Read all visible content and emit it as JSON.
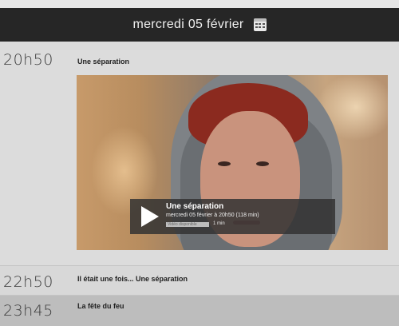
{
  "header": {
    "date": "mercredi 05 février",
    "calendar_icon": "calendar-icon"
  },
  "schedule": [
    {
      "time": "20h50",
      "title": "Une séparation"
    },
    {
      "time": "22h50",
      "title": "Il était une fois... Une séparation"
    },
    {
      "time": "23h45",
      "title": "La fête du feu"
    }
  ],
  "player": {
    "title": "Une séparation",
    "subtitle": "mercredi 05 février à 20h50 (118 min)",
    "bar_label": "Vidéo disponible",
    "duration": "1 min",
    "play_icon": "play-icon"
  }
}
